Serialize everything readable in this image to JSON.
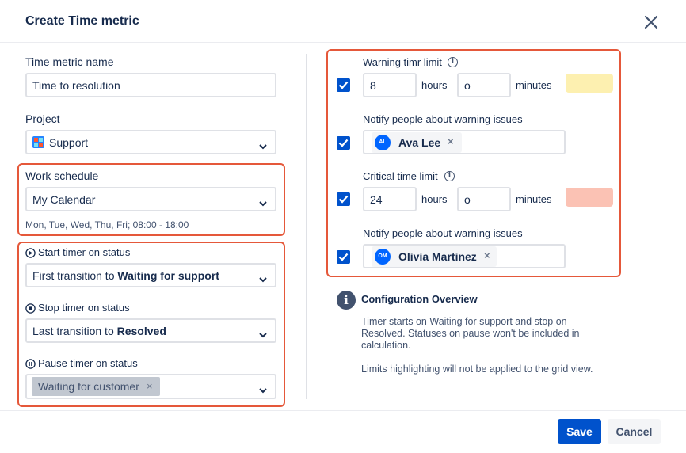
{
  "dialog": {
    "title": "Create Time metric"
  },
  "left": {
    "name_label": "Time metric name",
    "name_value": "Time to resolution",
    "project_label": "Project",
    "project_value": "Support",
    "schedule_label": "Work schedule",
    "schedule_value": "My Calendar",
    "schedule_hint": "Mon, Tue, Wed, Thu, Fri; 08:00 - 18:00",
    "start_label": "Start timer on status",
    "start_prefix": "First transition to ",
    "start_status": "Waiting for support",
    "stop_label": "Stop timer on status",
    "stop_prefix": "Last transition to ",
    "stop_status": "Resolved",
    "pause_label": "Pause timer on status",
    "pause_chip": "Waiting for customer",
    "chip_remove": "×"
  },
  "right": {
    "warning": {
      "label": "Warning timr limit",
      "hours_value": "8",
      "hours_unit": "hours",
      "minutes_value": "o",
      "minutes_unit": "minutes",
      "color": "#fdf0b0",
      "checked": true
    },
    "notify_warning": {
      "label": "Notify people about warning issues",
      "user_initials": "AL",
      "user_name": "Ava Lee",
      "remove": "×",
      "checked": true
    },
    "critical": {
      "label": "Critical time limit",
      "hours_value": "24",
      "hours_unit": "hours",
      "minutes_value": "o",
      "minutes_unit": "minutes",
      "color": "#fbc2b4",
      "checked": true
    },
    "notify_critical": {
      "label": "Notify people about warning issues",
      "user_initials": "OM",
      "user_name": "Olivia Martinez",
      "remove": "×",
      "checked": true
    },
    "overview": {
      "title": "Configuration Overview",
      "text1": "Timer starts on Waiting for support and stop on Resolved. Statuses on pause won't be included in calculation.",
      "text2": "Limits highlighting will not be applied to the grid view."
    }
  },
  "footer": {
    "save_label": "Save",
    "cancel_label": "Cancel"
  },
  "colors": {
    "accent": "#0052cc",
    "highlight_border": "#e5583a"
  }
}
